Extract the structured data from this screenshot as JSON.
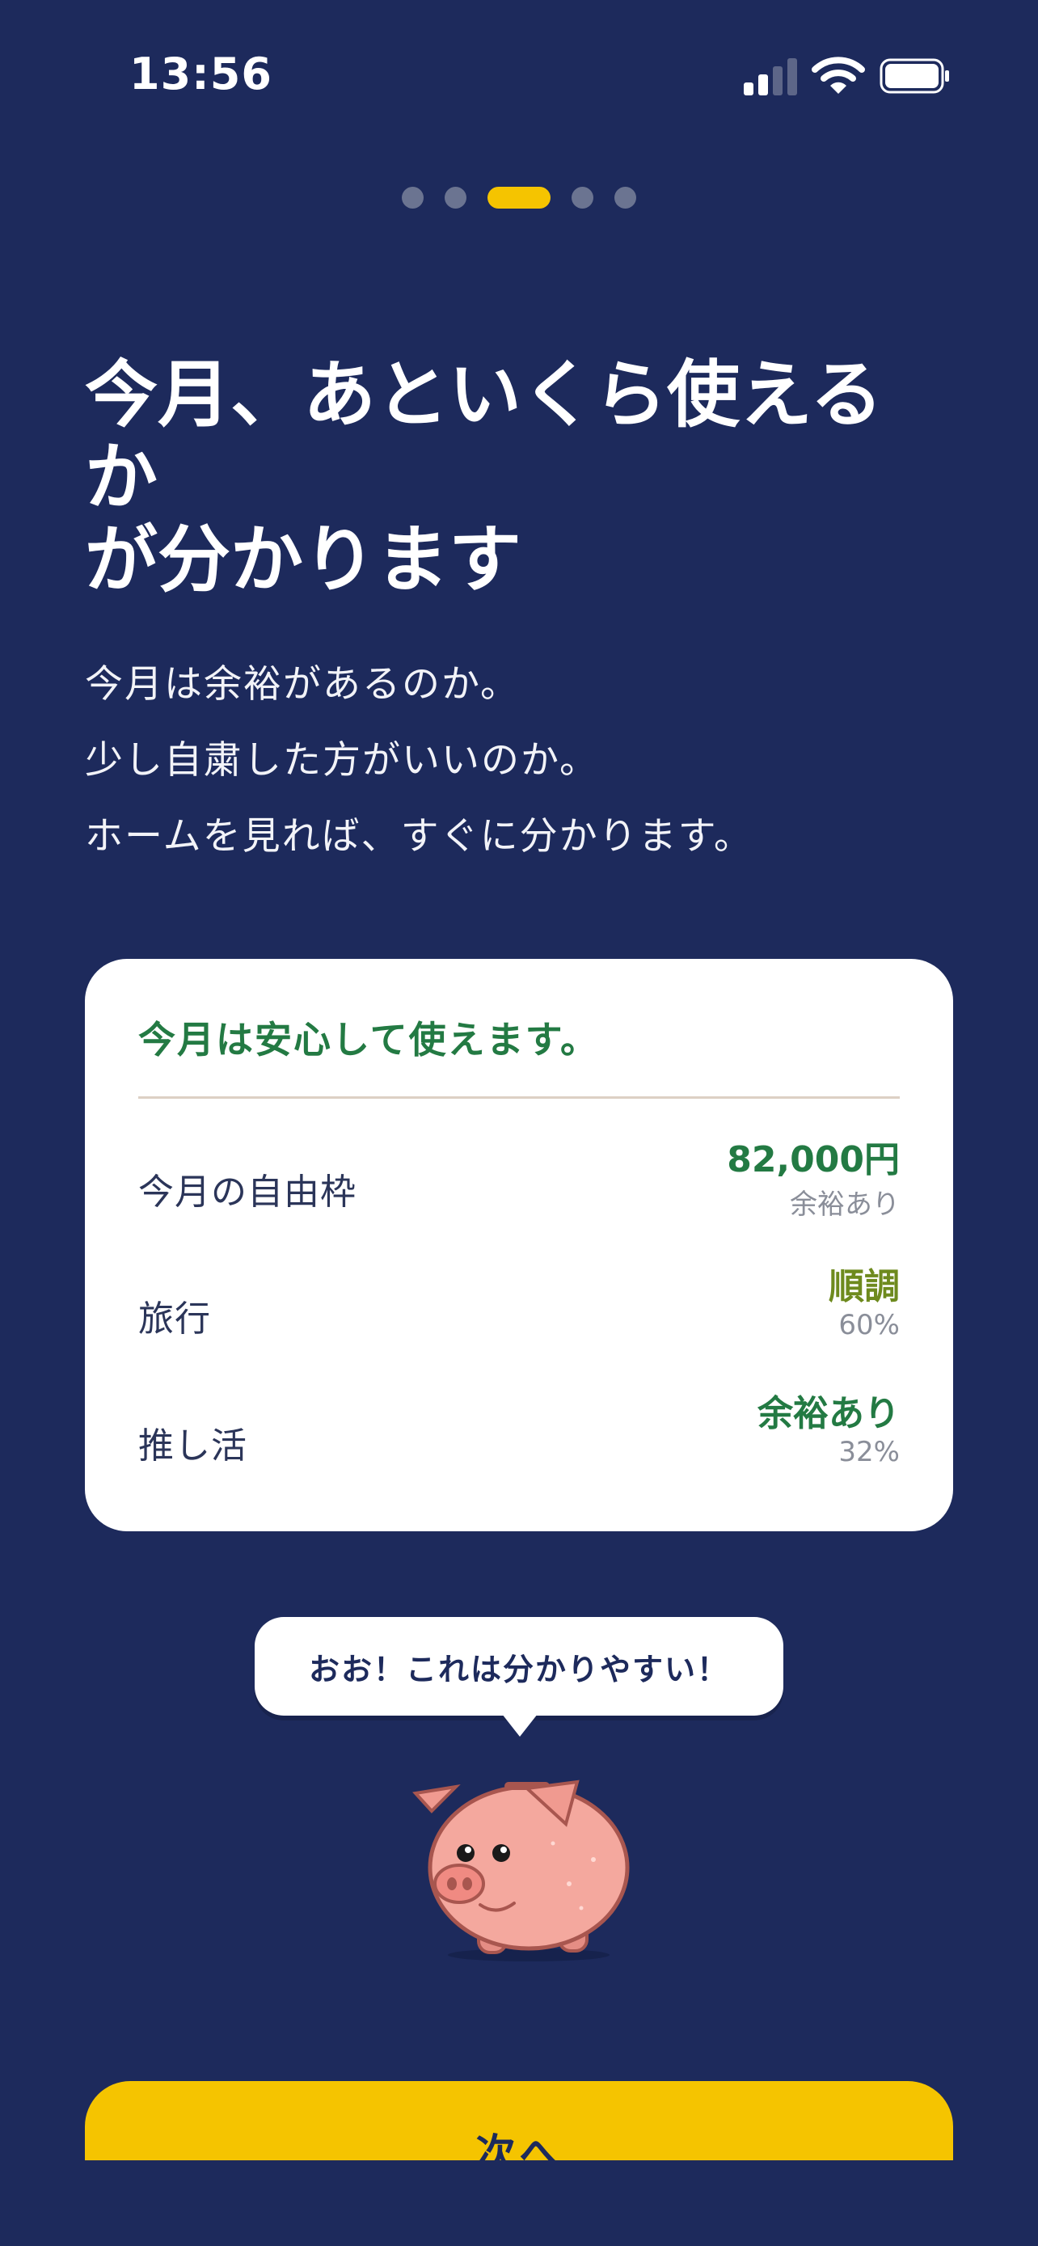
{
  "status_bar": {
    "time": "13:56"
  },
  "pager": {
    "total": 5,
    "active_index": 2
  },
  "title_lines": [
    "今月、あといくら使える",
    "か",
    "が分かります"
  ],
  "description": [
    "今月は余裕があるのか。",
    "少し自粛した方がいいのか。",
    "ホームを見れば、すぐに分かります。"
  ],
  "card": {
    "heading": "今月は安心して使えます。",
    "rows": [
      {
        "label": "今月の自由枠",
        "value": "82,000円",
        "sub": "余裕あり",
        "value_color": "#237a43"
      },
      {
        "label": "旅行",
        "value": "順調",
        "sub": "60%",
        "value_color": "#6e8a1e"
      },
      {
        "label": "推し活",
        "value": "余裕あり",
        "sub": "32%",
        "value_color": "#237a43"
      }
    ]
  },
  "bubble": {
    "text": "おお！これは分かりやすい！"
  },
  "mascot": {
    "icon": "piggy-bank-icon"
  },
  "next_button": {
    "label": "次へ"
  },
  "colors": {
    "background": "#1d2a5c",
    "accent": "#f5c400",
    "positive": "#237a43",
    "on_track": "#6e8a1e"
  }
}
